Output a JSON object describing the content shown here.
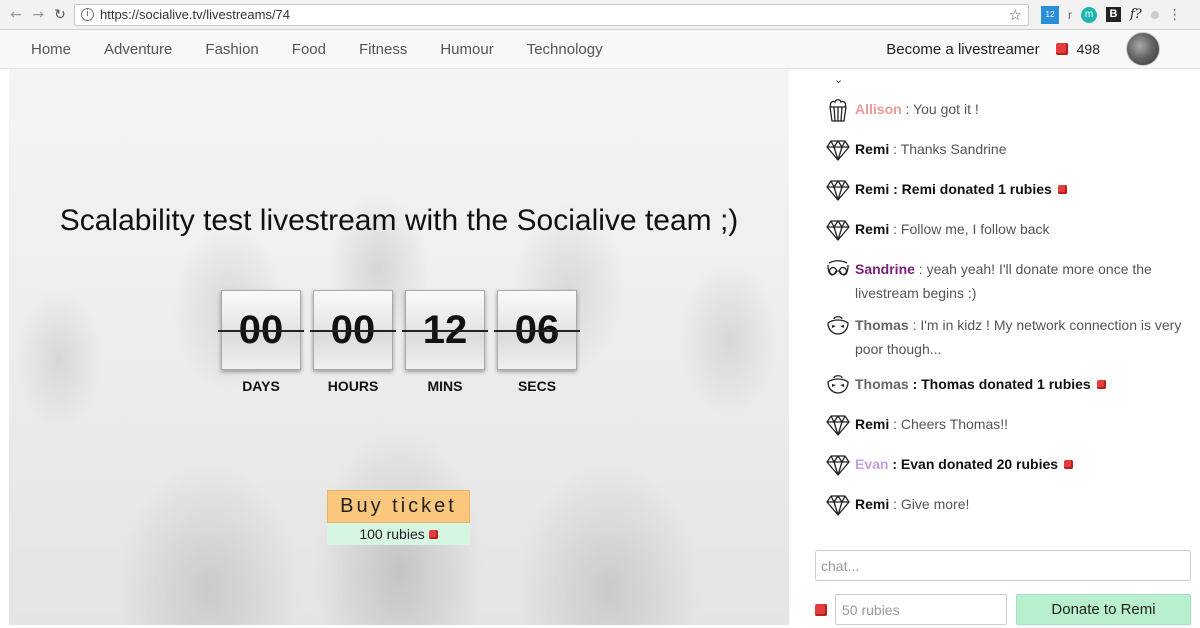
{
  "browser": {
    "url": "https://socialive.tv/livestreams/74"
  },
  "nav": {
    "menu": [
      "Home",
      "Adventure",
      "Fashion",
      "Food",
      "Fitness",
      "Humour",
      "Technology"
    ],
    "become_label": "Become a livestreamer",
    "ruby_count": "498"
  },
  "stream": {
    "title": "Scalability test livestream with the Socialive team ;)",
    "countdown": [
      {
        "value": "00",
        "label": "DAYS"
      },
      {
        "value": "00",
        "label": "HOURS"
      },
      {
        "value": "12",
        "label": "MINS"
      },
      {
        "value": "06",
        "label": "SECS"
      }
    ],
    "ticket_label": "Buy ticket",
    "ticket_price": "100 rubies"
  },
  "chat": {
    "messages": [
      {
        "user": "Allison",
        "icon": "popcorn-icon",
        "kind": "text",
        "text": " : You got it !",
        "user_class": "allison"
      },
      {
        "user": "Remi",
        "icon": "diamond-icon",
        "kind": "text",
        "text": " : Thanks Sandrine",
        "user_class": "remi"
      },
      {
        "user": "Remi",
        "icon": "diamond-icon",
        "kind": "donation",
        "text": " : Remi donated 1 rubies",
        "user_class": "remi"
      },
      {
        "user": "Remi",
        "icon": "diamond-icon",
        "kind": "text",
        "text": " : Follow me, I follow back",
        "user_class": "remi"
      },
      {
        "user": "Sandrine",
        "icon": "glasses-icon",
        "kind": "text",
        "text": " : yeah yeah! I'll donate more once the livestream begins :)",
        "user_class": "sandrine"
      },
      {
        "user": "Thomas",
        "icon": "mask-icon",
        "kind": "text",
        "text": " : I'm in kidz ! My network connection is very poor though...",
        "user_class": "thomas"
      },
      {
        "user": "Thomas",
        "icon": "mask-icon",
        "kind": "donation",
        "text": " : Thomas donated 1 rubies",
        "user_class": "thomas"
      },
      {
        "user": "Remi",
        "icon": "diamond-icon",
        "kind": "text",
        "text": " : Cheers Thomas!!",
        "user_class": "remi"
      },
      {
        "user": "Evan",
        "icon": "diamond-icon",
        "kind": "donation",
        "text": " : Evan donated 20 rubies",
        "user_class": "evan"
      },
      {
        "user": "Remi",
        "icon": "diamond-icon",
        "kind": "text",
        "text": " : Give more!",
        "user_class": "remi"
      }
    ],
    "input_placeholder": "chat...",
    "donate_placeholder": "50 rubies",
    "donate_label": "Donate to Remi"
  }
}
